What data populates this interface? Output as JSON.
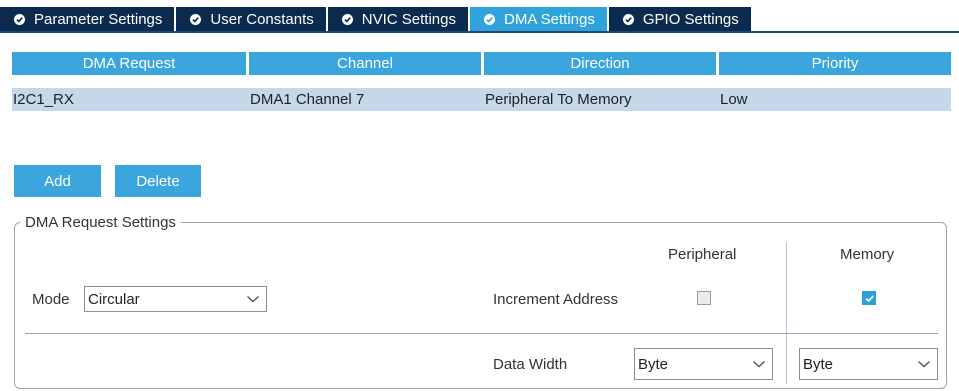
{
  "tabs": [
    {
      "label": "Parameter Settings",
      "active": false
    },
    {
      "label": "User Constants",
      "active": false
    },
    {
      "label": "NVIC Settings",
      "active": false
    },
    {
      "label": "DMA Settings",
      "active": true
    },
    {
      "label": "GPIO Settings",
      "active": false
    }
  ],
  "table": {
    "headers": [
      "DMA Request",
      "Channel",
      "Direction",
      "Priority"
    ],
    "rows": [
      [
        "I2C1_RX",
        "DMA1 Channel 7",
        "Peripheral To Memory",
        "Low"
      ]
    ]
  },
  "buttons": {
    "add": "Add",
    "delete": "Delete"
  },
  "settings": {
    "legend": "DMA Request Settings",
    "peripheral_header": "Peripheral",
    "memory_header": "Memory",
    "mode_label": "Mode",
    "mode_value": "Circular",
    "increment_label": "Increment Address",
    "increment_peripheral": false,
    "increment_memory": true,
    "data_width_label": "Data Width",
    "data_width_peripheral": "Byte",
    "data_width_memory": "Byte"
  },
  "icons": {
    "tab_status": "check-circle-icon",
    "dropdown": "chevron-down-icon",
    "checkbox_checked": "check-icon"
  },
  "colors": {
    "tab_bg": "#0b2a4e",
    "tab_active": "#2fa3dc",
    "header_bg": "#3aa6dd",
    "row_selected": "#c5d8ea",
    "button_bg": "#3aa6dd"
  }
}
